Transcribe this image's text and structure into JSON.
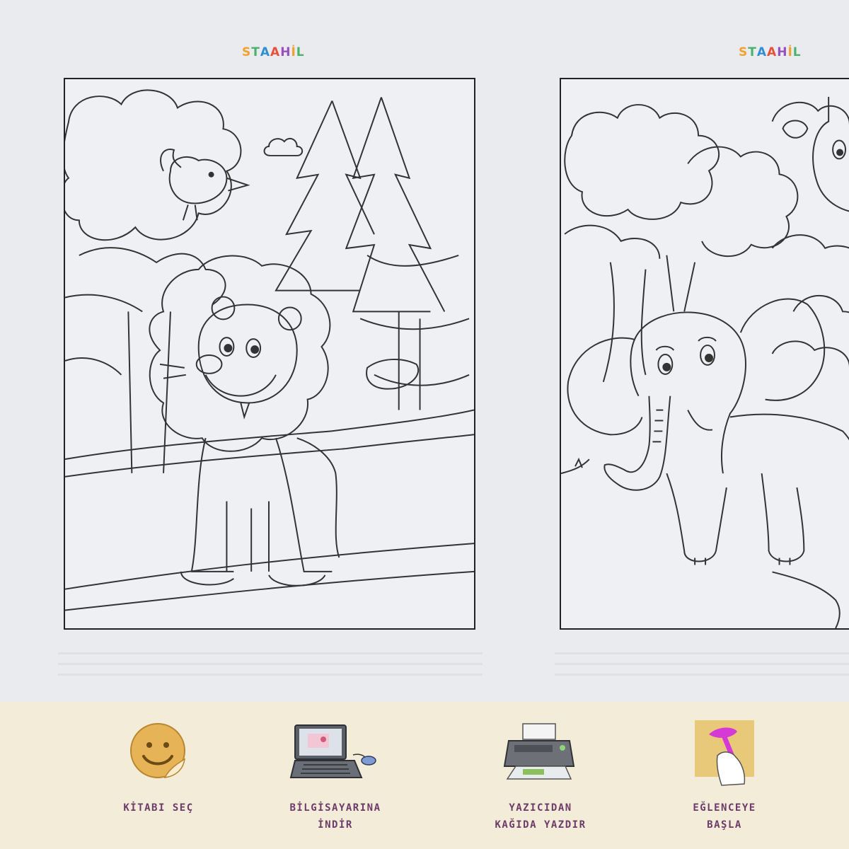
{
  "pages": [
    {
      "brand": "STAAHL",
      "subject": "lion"
    },
    {
      "brand": "STAAHL",
      "subject": "elephant"
    }
  ],
  "steps": [
    {
      "icon": "smiley-sticker-icon",
      "label": "KİTABI SEÇ"
    },
    {
      "icon": "laptop-icon",
      "label": "BİLGİSAYARINA\nİNDİR"
    },
    {
      "icon": "printer-icon",
      "label": "YAZICIDAN\nKAĞIDA YAZDIR"
    },
    {
      "icon": "crayon-hand-icon",
      "label": "EĞLENCEYE\nBAŞLA"
    }
  ],
  "colors": {
    "background": "#eaebef",
    "steps_bar": "#f3ecd9",
    "step_text": "#6c3b6a",
    "sheet_border": "#222222",
    "crayon": "#d63ad6"
  }
}
